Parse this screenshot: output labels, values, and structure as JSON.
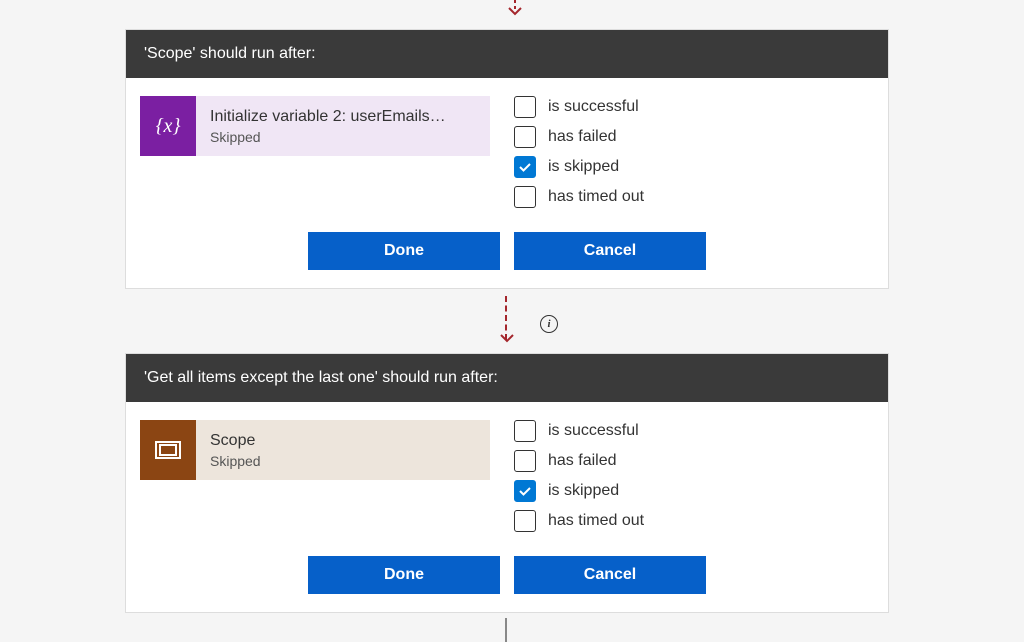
{
  "cards": [
    {
      "header": "'Scope' should run after:",
      "prevAction": {
        "iconType": "variable",
        "iconText": "{x}",
        "title": "Initialize variable 2: userEmails…",
        "status": "Skipped"
      },
      "conditions": {
        "successful": {
          "label": "is successful",
          "checked": false
        },
        "failed": {
          "label": "has failed",
          "checked": false
        },
        "skipped": {
          "label": "is skipped",
          "checked": true
        },
        "timedout": {
          "label": "has timed out",
          "checked": false
        }
      },
      "buttons": {
        "done": "Done",
        "cancel": "Cancel"
      }
    },
    {
      "header": "'Get all items except the last one' should run after:",
      "prevAction": {
        "iconType": "scope",
        "title": "Scope",
        "status": "Skipped"
      },
      "conditions": {
        "successful": {
          "label": "is successful",
          "checked": false
        },
        "failed": {
          "label": "has failed",
          "checked": false
        },
        "skipped": {
          "label": "is skipped",
          "checked": true
        },
        "timedout": {
          "label": "has timed out",
          "checked": false
        }
      },
      "buttons": {
        "done": "Done",
        "cancel": "Cancel"
      }
    }
  ],
  "infoIcon": "i"
}
